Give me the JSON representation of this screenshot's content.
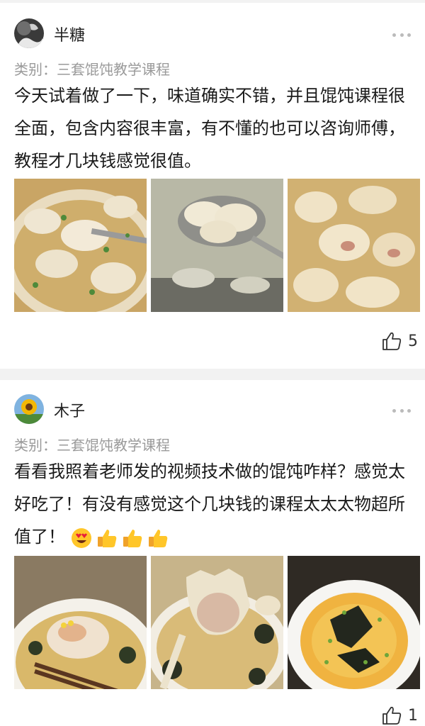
{
  "colors": {
    "separator": "#f2f2f2",
    "meta_gray": "#9a9a9a",
    "text": "#1a1a1a"
  },
  "posts": [
    {
      "username": "半糖",
      "category": "类别：三套馄饨教学课程",
      "content": "今天试着做了一下，味道确实不错，并且馄饨课程很全面，包含内容很丰富，有不懂的也可以咨询师傅，教程才几块钱感觉很值。",
      "photos": [
        "wonton-soup-bowl-photo",
        "wonton-ladle-photo",
        "wontons-close-up-photo"
      ],
      "likes": "5",
      "avatar": "black-white-avatar"
    },
    {
      "username": "木子",
      "category": "类别：三套馄饨教学课程",
      "content": "看看我照着老师发的视频技术做的馄饨咋样？感觉太好吃了！有没有感觉这个几块钱的课程太太太物超所值了！",
      "emoji": [
        "heart-eyes-emoji",
        "thumbs-up-emoji",
        "thumbs-up-emoji",
        "thumbs-up-emoji"
      ],
      "photos": [
        "wonton-chopsticks-photo",
        "wonton-spoon-photo",
        "seaweed-soup-photo"
      ],
      "likes": "1",
      "avatar": "sunflower-avatar"
    }
  ]
}
